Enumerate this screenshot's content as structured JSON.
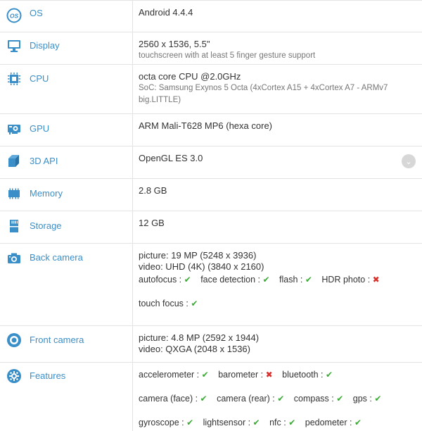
{
  "rows": {
    "os": {
      "label": "OS",
      "value": "Android 4.4.4"
    },
    "display": {
      "label": "Display",
      "value": "2560 x 1536, 5.5\"",
      "sub": "touchscreen with at least 5 finger gesture support"
    },
    "cpu": {
      "label": "CPU",
      "value": "octa core CPU @2.0GHz",
      "sub1": "SoC: Samsung Exynos 5 Octa (4xCortex A15 + 4xCortex A7 - ARMv7",
      "sub2": "big.LITTLE)"
    },
    "gpu": {
      "label": "GPU",
      "value": "ARM Mali-T628 MP6 (hexa core)"
    },
    "api": {
      "label": "3D API",
      "value": "OpenGL ES 3.0"
    },
    "memory": {
      "label": "Memory",
      "value": "2.8 GB"
    },
    "storage": {
      "label": "Storage",
      "value": "12 GB"
    },
    "back_camera": {
      "label": "Back camera",
      "picture": "picture: 19 MP (5248 x 3936)",
      "video": "video: UHD (4K) (3840 x 2160)",
      "features_line1": [
        {
          "name": "autofocus :",
          "supported": true
        },
        {
          "name": "face detection :",
          "supported": true
        },
        {
          "name": "flash :",
          "supported": true
        },
        {
          "name": "HDR photo :",
          "supported": false
        }
      ],
      "features_line2": [
        {
          "name": "touch focus :",
          "supported": true
        }
      ]
    },
    "front_camera": {
      "label": "Front camera",
      "picture": "picture: 4.8 MP (2592 x 1944)",
      "video": "video: QXGA (2048 x 1536)"
    },
    "features": {
      "label": "Features",
      "line1": [
        {
          "name": "accelerometer :",
          "supported": true
        },
        {
          "name": "barometer :",
          "supported": false
        },
        {
          "name": "bluetooth :",
          "supported": true
        }
      ],
      "line2": [
        {
          "name": "camera (face) :",
          "supported": true
        },
        {
          "name": "camera (rear) :",
          "supported": true
        },
        {
          "name": "compass :",
          "supported": true
        },
        {
          "name": "gps :",
          "supported": true
        }
      ],
      "line3": [
        {
          "name": "gyroscope :",
          "supported": true
        },
        {
          "name": "lightsensor :",
          "supported": true
        },
        {
          "name": "nfc :",
          "supported": true
        },
        {
          "name": "pedometer :",
          "supported": true
        }
      ]
    }
  },
  "symbols": {
    "yes": "✔",
    "no": "✖",
    "chevron": "⌄"
  },
  "colors": {
    "label": "#3a8fc9",
    "yes": "#3aaa35",
    "no": "#d9302c",
    "border": "#e3e3e3"
  }
}
